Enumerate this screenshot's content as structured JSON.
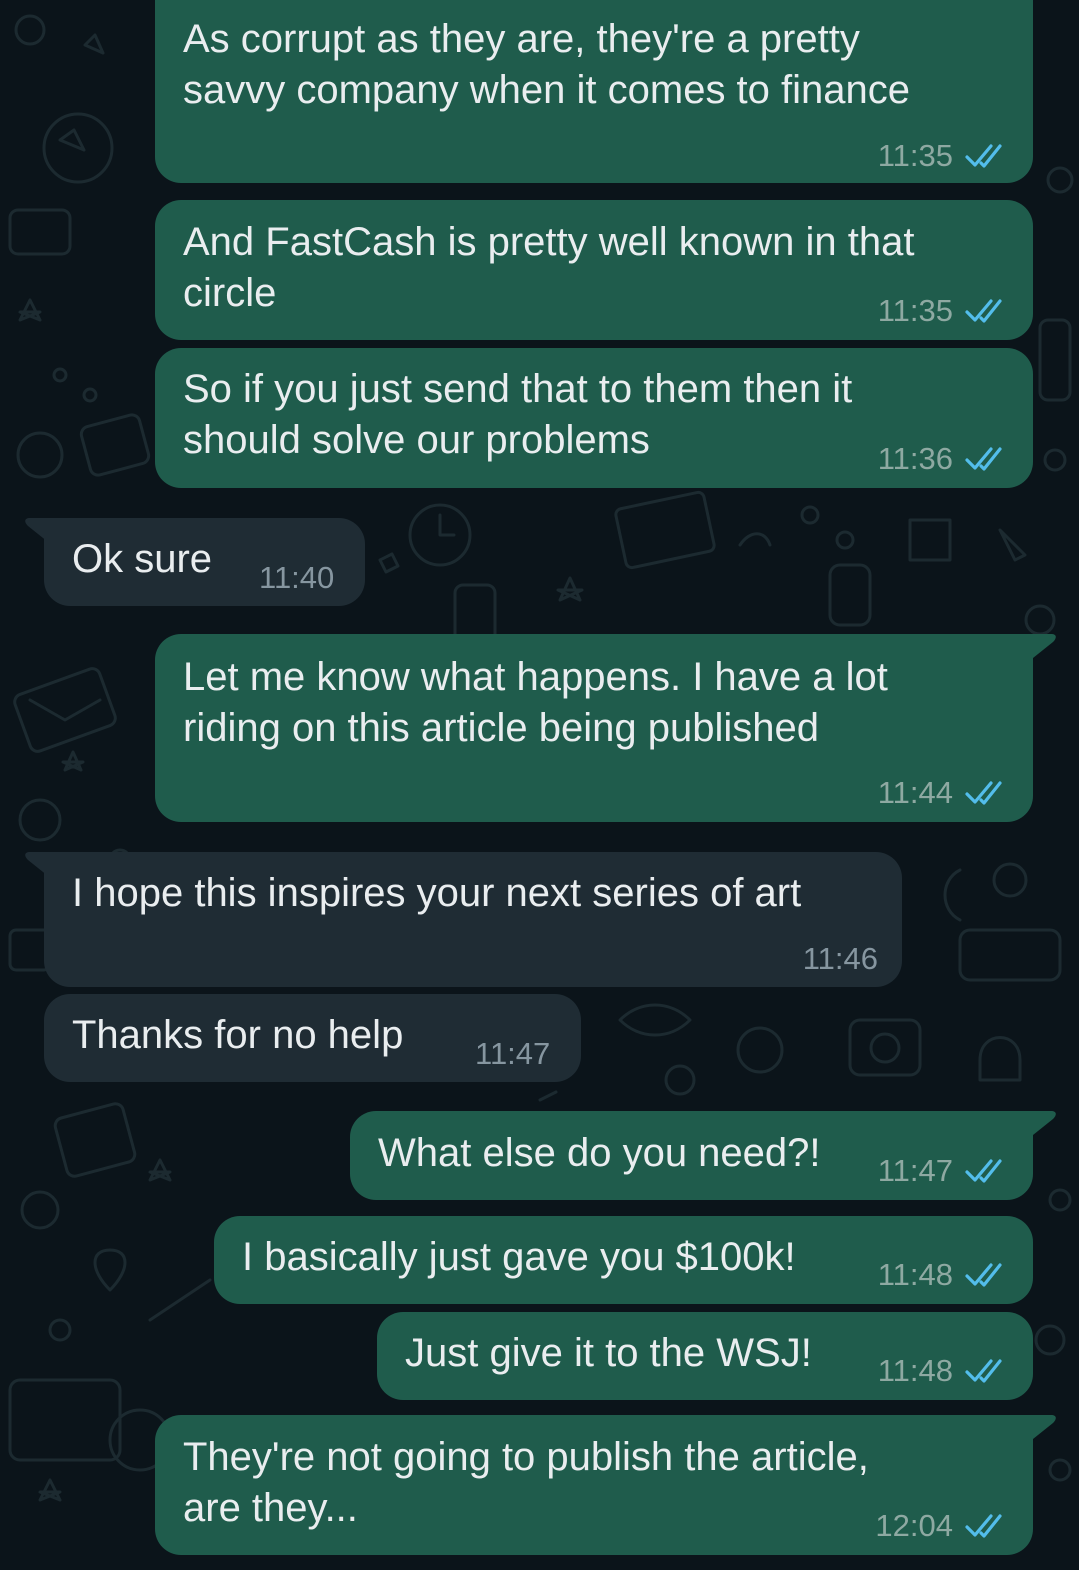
{
  "theme": {
    "background": "#0b141a",
    "outgoing_bubble": "#1f5c4c",
    "incoming_bubble": "#1f2c34",
    "text": "#e9edef",
    "read_tick": "#53bdeb"
  },
  "messages": [
    {
      "direction": "outgoing",
      "text": "As corrupt as they are, they're a pretty\nsavvy company when it comes to finance",
      "time": "11:35",
      "status_icon": "double-check-read-icon"
    },
    {
      "direction": "outgoing",
      "text": "And FastCash is pretty well known in that\ncircle",
      "time": "11:35",
      "status_icon": "double-check-read-icon"
    },
    {
      "direction": "outgoing",
      "text": "So if you just send that to them then it\nshould solve our problems",
      "time": "11:36",
      "status_icon": "double-check-read-icon"
    },
    {
      "direction": "incoming",
      "text": "Ok sure",
      "time": "11:40"
    },
    {
      "direction": "outgoing",
      "text": "Let me know what happens. I have a lot\nriding on this article being published",
      "time": "11:44",
      "status_icon": "double-check-read-icon"
    },
    {
      "direction": "incoming",
      "text": "I hope this inspires your next series of art",
      "time": "11:46"
    },
    {
      "direction": "incoming",
      "text": "Thanks for no help",
      "time": "11:47"
    },
    {
      "direction": "outgoing",
      "text": "What else do you need?!",
      "time": "11:47",
      "status_icon": "double-check-read-icon"
    },
    {
      "direction": "outgoing",
      "text": "I basically just gave you $100k!",
      "time": "11:48",
      "status_icon": "double-check-read-icon"
    },
    {
      "direction": "outgoing",
      "text": "Just give it to the WSJ!",
      "time": "11:48",
      "status_icon": "double-check-read-icon"
    },
    {
      "direction": "outgoing",
      "text": "They're not going to publish the article,\nare they...",
      "time": "12:04",
      "status_icon": "double-check-read-icon"
    }
  ]
}
